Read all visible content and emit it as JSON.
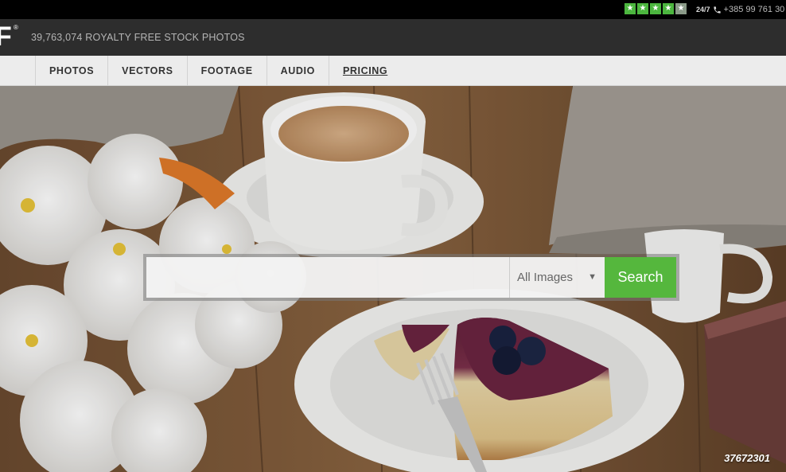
{
  "topbar": {
    "rating_stars": 5,
    "rating_filled": 4,
    "support_hours": "24/7",
    "phone": "+385 99 761 30"
  },
  "header": {
    "logo_letter": "F",
    "logo_mark": "®",
    "tagline": "39,763,074  ROYALTY FREE STOCK PHOTOS"
  },
  "nav": {
    "items": [
      {
        "label": "PHOTOS"
      },
      {
        "label": "VECTORS"
      },
      {
        "label": "FOOTAGE"
      },
      {
        "label": "AUDIO"
      },
      {
        "label": "PRICING"
      }
    ]
  },
  "search": {
    "placeholder": "",
    "value": "",
    "category_selected": "All Images",
    "button_label": "Search"
  },
  "hero": {
    "image_id": "37672301",
    "icon": "hero-photo-coffee-cheesecake"
  },
  "colors": {
    "accent_green": "#55b73d",
    "star_green": "#4cb63f",
    "topbar_bg": "#000000",
    "logobar_bg": "#2d2d2d",
    "navbar_bg": "#ececec"
  }
}
